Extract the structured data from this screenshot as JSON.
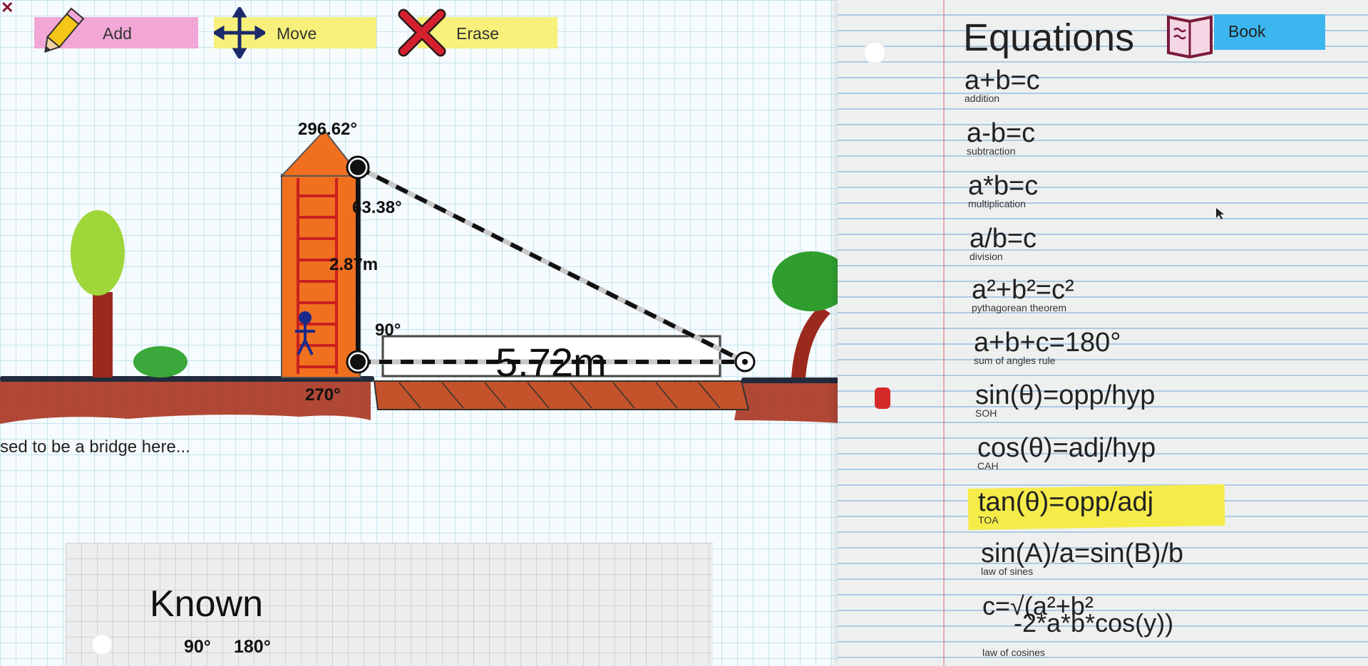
{
  "toolbar": {
    "close_glyph": "✕",
    "add_label": "Add",
    "move_label": "Move",
    "erase_label": "Erase",
    "book_label": "Book"
  },
  "scene": {
    "angle_top": "296.62°",
    "angle_upper": "63.38°",
    "height_label": "2.87m",
    "angle_right": "90°",
    "angle_bottom": "270°",
    "distance_label": "5.72m",
    "story_text": "sed to be a bridge here..."
  },
  "equations": {
    "title": "Equations",
    "items": [
      {
        "formula": "a+b=c",
        "name": "addition"
      },
      {
        "formula": "a-b=c",
        "name": "subtraction"
      },
      {
        "formula": "a*b=c",
        "name": "multiplication"
      },
      {
        "formula": "a/b=c",
        "name": "division"
      },
      {
        "formula": "a²+b²=c²",
        "name": "pythagorean theorem"
      },
      {
        "formula": "a+b+c=180°",
        "name": "sum of angles rule"
      },
      {
        "formula": "sin(θ)=opp/hyp",
        "name": "SOH"
      },
      {
        "formula": "cos(θ)=adj/hyp",
        "name": "CAH"
      },
      {
        "formula": "tan(θ)=opp/adj",
        "name": "TOA"
      },
      {
        "formula": "sin(A)/a=sin(B)/b",
        "name": "law of sines"
      },
      {
        "formula_line1": "c=√(a²+b²",
        "formula_line2": "-2*a*b*cos(y))",
        "name": "law of cosines"
      }
    ],
    "highlight_color": "#f5ec4a"
  },
  "known": {
    "title": "Known",
    "values": [
      "90°",
      "180°"
    ]
  },
  "icons": [
    "pencil-icon",
    "move-arrows-icon",
    "erase-x-icon",
    "book-icon",
    "close-icon"
  ],
  "colors": {
    "add_tape": "#f2a7d6",
    "move_tape": "#f7f07a",
    "erase_tape": "#f7f07a",
    "book_tape": "#3cb6ee",
    "tower": "#f07020",
    "ground": "#9b2a1e"
  }
}
